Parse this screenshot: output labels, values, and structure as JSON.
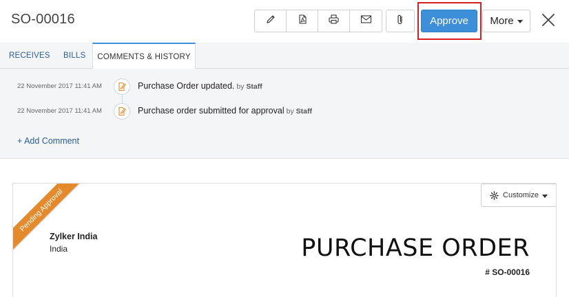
{
  "header": {
    "title": "SO-00016",
    "toolbar": [
      {
        "name": "edit-button",
        "icon": "pencil-icon"
      },
      {
        "name": "pdf-button",
        "icon": "pdf-icon"
      },
      {
        "name": "print-button",
        "icon": "printer-icon"
      },
      {
        "name": "email-button",
        "icon": "mail-icon"
      }
    ],
    "attach_icon": "paperclip-icon",
    "approve_label": "Approve",
    "more_label": "More",
    "close_icon": "close-icon"
  },
  "tabs": [
    {
      "label": "RECEIVES",
      "active": false
    },
    {
      "label": "BILLS",
      "active": false
    },
    {
      "label": "COMMENTS & HISTORY",
      "active": true
    }
  ],
  "history": [
    {
      "time": "22 November 2017 11:41 AM",
      "text": "Purchase Order updated.",
      "by_prefix": "by",
      "by": "Staff"
    },
    {
      "time": "22 November 2017 11:41 AM",
      "text": "Purchase order submitted for approval",
      "by_prefix": "by",
      "by": "Staff"
    }
  ],
  "add_comment_label": "+ Add Comment",
  "document": {
    "status_ribbon": "Pending Approval",
    "customize_label": "Customize",
    "org_name": "Zylker India",
    "org_country": "India",
    "title": "PURCHASE ORDER",
    "number": "# SO-00016"
  },
  "colors": {
    "accent": "#3c8fd8",
    "highlight": "#d61d23",
    "ribbon": "#e58a2c",
    "link": "#2a5d96"
  }
}
